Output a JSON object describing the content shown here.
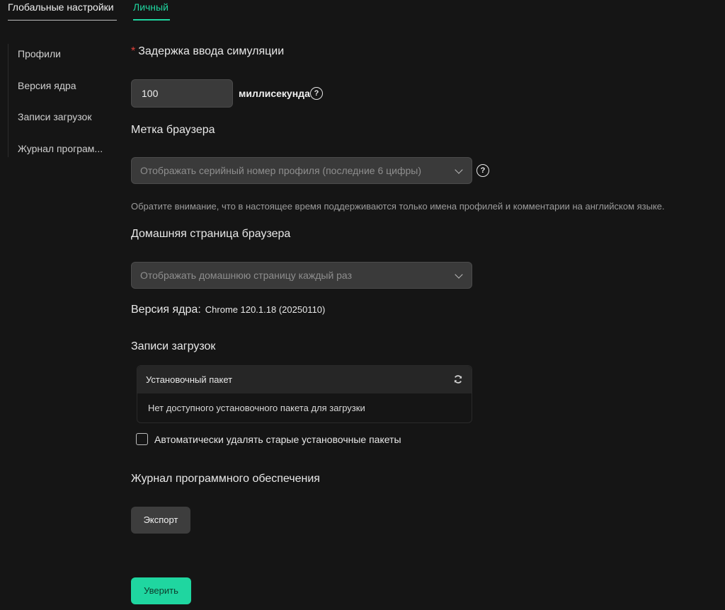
{
  "tabs": {
    "global": "Глобальные настройки",
    "personal": "Личный"
  },
  "sidebar": {
    "items": [
      "Профили",
      "Версия ядра",
      "Записи загрузок",
      "Журнал програм..."
    ]
  },
  "input_delay": {
    "label": "Задержка ввода симуляции",
    "required_mark": "*",
    "value": "100",
    "unit": "миллисекунда"
  },
  "browser_label": {
    "label": "Метка браузера",
    "selected": "Отображать серийный номер профиля (последние 6 цифры)",
    "note": "Обратите внимание, что в настоящее время поддерживаются только имена профилей и комментарии на английском языке."
  },
  "homepage": {
    "label": "Домашняя страница браузера",
    "selected": "Отображать домашнюю страницу каждый раз"
  },
  "kernel": {
    "label": "Версия ядра:",
    "value": "Chrome 120.1.18 (20250110)"
  },
  "downloads": {
    "label": "Записи загрузок",
    "header": "Установочный пакет",
    "empty": "Нет доступного установочного пакета для загрузки",
    "auto_delete": "Автоматически удалять старые установочные пакеты",
    "auto_delete_checked": false
  },
  "software_log": {
    "label": "Журнал программного обеспечения",
    "export": "Экспорт"
  },
  "confirm": "Уверить",
  "colors": {
    "accent": "#1fd6a0",
    "background": "#151515",
    "required": "#e0413a"
  },
  "icons": {
    "help": "question-circle-icon",
    "chevron": "chevron-down-icon",
    "refresh": "refresh-icon"
  }
}
